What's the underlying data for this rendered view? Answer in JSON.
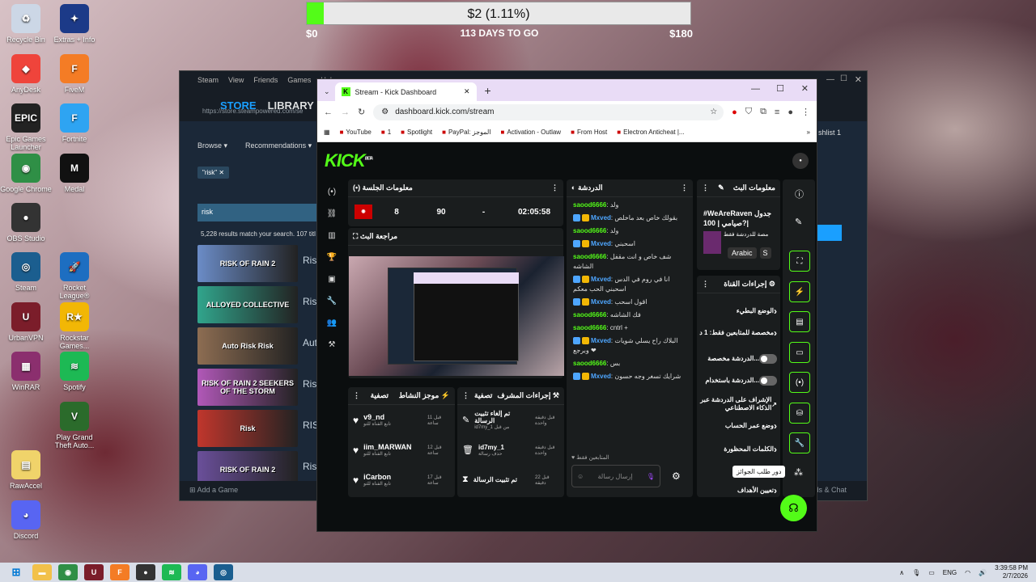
{
  "desktop": {
    "icons": [
      {
        "label": "Recycle Bin",
        "color": "#ccd7e6",
        "glyph": "♻"
      },
      {
        "label": "Extras + Info",
        "color": "#1c3a88",
        "glyph": "✦"
      },
      {
        "label": "AnyDesk",
        "color": "#ef443b",
        "glyph": "◆"
      },
      {
        "label": "FiveM",
        "color": "#f47c25",
        "glyph": "F"
      },
      {
        "label": "Epic Games Launcher",
        "color": "#222",
        "glyph": "EPIC"
      },
      {
        "label": "Fortnite",
        "color": "#2ea4f2",
        "glyph": "F"
      },
      {
        "label": "Google Chrome",
        "color": "#2f8f46",
        "glyph": "◉"
      },
      {
        "label": "Medal",
        "color": "#111",
        "glyph": "M"
      },
      {
        "label": "OBS Studio",
        "color": "#333",
        "glyph": "●"
      },
      {
        "label": "Steam",
        "color": "#1b5e8f",
        "glyph": "◎"
      },
      {
        "label": "Rocket League®",
        "color": "#1d6ec1",
        "glyph": "🚀"
      },
      {
        "label": "UrbanVPN",
        "color": "#7b1d2a",
        "glyph": "U"
      },
      {
        "label": "Rockstar Games...",
        "color": "#f2b705",
        "glyph": "R★"
      },
      {
        "label": "WinRAR",
        "color": "#8b2f6e",
        "glyph": "▦"
      },
      {
        "label": "Spotify",
        "color": "#1db954",
        "glyph": "≋"
      },
      {
        "label": "Play Grand Theft Auto...",
        "color": "#2b6b2b",
        "glyph": "V"
      },
      {
        "label": "RawAccel",
        "color": "#f0d36a",
        "glyph": "▤"
      },
      {
        "label": "Discord",
        "color": "#5865f2",
        "glyph": "◕"
      }
    ]
  },
  "goal": {
    "amount": "$2 (1.11%)",
    "start": "$0",
    "days": "113 DAYS TO GO",
    "end": "$180",
    "progress": 0.0111
  },
  "steam": {
    "menu": [
      "Steam",
      "View",
      "Friends",
      "Games",
      "Help"
    ],
    "nav": [
      "STORE",
      "LIBRARY",
      "C"
    ],
    "url": "https://store.steampowered.com/se",
    "browse": "Browse ▾",
    "recommendations": "Recommendations ▾",
    "wishlist": "shlist",
    "wishlist_count": "1",
    "chip": "\"risk\"",
    "search": "risk",
    "results_text": "5,228 results match your search. 107 titl",
    "add_game": "Add a Game",
    "friends": "ds & Chat",
    "results": [
      {
        "title": "RISK OF RAIN 2",
        "label": "Risk",
        "color": "#6b8cc7"
      },
      {
        "title": "ALLOYED COLLECTIVE",
        "label": "Risk",
        "color": "#31a58c"
      },
      {
        "title": "Auto Risk Risk",
        "label": "Aut",
        "color": "#8d6d52"
      },
      {
        "title": "RISK OF RAIN 2 SEEKERS OF THE STORM",
        "label": "Risk",
        "color": "#b158b8"
      },
      {
        "title": "Risk",
        "label": "RISI",
        "color": "#c0362c"
      },
      {
        "title": "RISK OF RAIN 2",
        "label": "Risk",
        "color": "#6a4f9a"
      }
    ]
  },
  "chrome": {
    "tab_title": "Stream - Kick Dashboard",
    "url": "dashboard.kick.com/stream",
    "bookmarks": [
      "YouTube",
      "1",
      "Spotlight",
      "PayPal: الموجز",
      "Activation - Outlaw",
      "From Host",
      "Electron Anticheat |..."
    ]
  },
  "kick": {
    "logo": "KICK",
    "logo_sup": "BETA",
    "session": {
      "title": "معلومات الجلسة",
      "stats": [
        "8",
        "90",
        "-",
        "02:05:58"
      ]
    },
    "preview": {
      "title": "مراجعة البث"
    },
    "chat": {
      "title": "الدردشة",
      "followers_only": "المتابعين فقط",
      "input_placeholder": "إرسال رسالة",
      "messages": [
        {
          "user": "saood6666",
          "text": "ولد",
          "badges": false,
          "color": "#53fc18"
        },
        {
          "user": "Mxved",
          "text": "بقولك خاص بعد ماخلص",
          "badges": true,
          "color": "#4ea6ff"
        },
        {
          "user": "saood6666",
          "text": "ولد",
          "badges": false,
          "color": "#53fc18"
        },
        {
          "user": "Mxved",
          "text": "اسحبني",
          "badges": true,
          "color": "#4ea6ff"
        },
        {
          "user": "saood6666",
          "text": "شف خاص و انت مقفل الشاشه",
          "badges": false,
          "color": "#53fc18"
        },
        {
          "user": "Mxved",
          "text": "انا في روم في الدس اسحبني الحب معكم",
          "badges": true,
          "color": "#4ea6ff"
        },
        {
          "user": "Mxved",
          "text": "اقول اسحب",
          "badges": true,
          "color": "#4ea6ff"
        },
        {
          "user": "saood6666",
          "text": "فك الشاشه",
          "badges": false,
          "color": "#53fc18"
        },
        {
          "user": "saood6666",
          "text": "cntrl +",
          "badges": false,
          "color": "#53fc18"
        },
        {
          "user": "Mxved",
          "text": "البلاك راح يسلي شويات وبرجع ❤",
          "badges": true,
          "color": "#4ea6ff"
        },
        {
          "user": "saood6666",
          "text": "بس",
          "badges": false,
          "color": "#53fc18"
        },
        {
          "user": "Mxved",
          "text": "شرايك تسغر وجه حسون",
          "badges": true,
          "color": "#4ea6ff"
        }
      ]
    },
    "stream_info": {
      "title": "معلومات البث",
      "stream_title": "#WeAreRaven جدول صيامي | 100?|",
      "note": "مصة للدردشة فقط",
      "tag": "Arabic",
      "tag2": "S"
    },
    "channel_actions": {
      "title": "إجراءات القناة",
      "items": [
        {
          "label": "الوضع البطيء",
          "type": "chevron"
        },
        {
          "label": "مخصصة للمتابعين فقط: 1 د",
          "type": "chevron"
        },
        {
          "label": "الدردشة مخصصة...",
          "type": "toggle"
        },
        {
          "label": "الدردشة باستخدام...",
          "type": "toggle"
        },
        {
          "label": "الإشراف على الدردشة عبر الذكاء الاصطناعي",
          "type": "link"
        },
        {
          "label": "وضع عمر الحساب",
          "type": "chevron"
        },
        {
          "label": "الكلمات المحظورة",
          "type": "chevron"
        },
        {
          "label": "تعيين الأهداف",
          "type": "chevron"
        }
      ]
    },
    "activity": {
      "title": "موجز النشاط",
      "filter": "تصفية",
      "rows": [
        {
          "name": "v9_nd",
          "sub": "تابع القناة للتو",
          "time": "قبل 11 ساعة"
        },
        {
          "name": "iim_MARWAN",
          "sub": "تابع القناة للتو",
          "time": "قبل 12 ساعة"
        },
        {
          "name": "iCarbon",
          "sub": "تابع القناة للتو",
          "time": "قبل 17 ساعة"
        }
      ]
    },
    "mod": {
      "title": "إجراءات المشرف",
      "filter": "تصفية",
      "rows": [
        {
          "name": "تم إلغاء تثبيت الرسالة",
          "sub": "من قبل id7my_1",
          "time": "قبل دقيقة واحدة"
        },
        {
          "name": "id7my_1",
          "sub": "حذف رسالة",
          "time": "قبل دقيقة واحدة"
        },
        {
          "name": "تم تثبيت الرسالة",
          "sub": "",
          "time": "قبل 22 دقيقة"
        }
      ]
    },
    "tooltip": "دور طلب الجوائز"
  },
  "taskbar": {
    "lang": "ENG",
    "time": "3:39:58 PM",
    "date": "2/7/2026"
  }
}
